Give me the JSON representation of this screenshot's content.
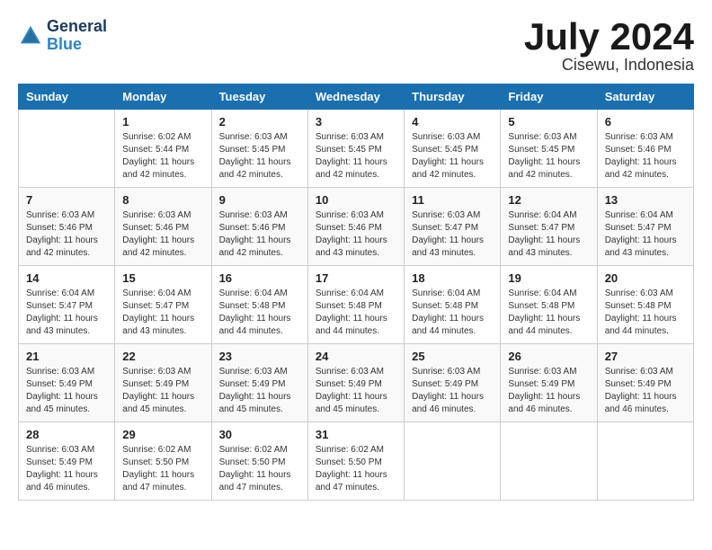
{
  "header": {
    "logo_line1": "General",
    "logo_line2": "Blue",
    "title": "July 2024",
    "subtitle": "Cisewu, Indonesia"
  },
  "days_of_week": [
    "Sunday",
    "Monday",
    "Tuesday",
    "Wednesday",
    "Thursday",
    "Friday",
    "Saturday"
  ],
  "weeks": [
    [
      {
        "day": "",
        "info": ""
      },
      {
        "day": "1",
        "info": "Sunrise: 6:02 AM\nSunset: 5:44 PM\nDaylight: 11 hours\nand 42 minutes."
      },
      {
        "day": "2",
        "info": "Sunrise: 6:03 AM\nSunset: 5:45 PM\nDaylight: 11 hours\nand 42 minutes."
      },
      {
        "day": "3",
        "info": "Sunrise: 6:03 AM\nSunset: 5:45 PM\nDaylight: 11 hours\nand 42 minutes."
      },
      {
        "day": "4",
        "info": "Sunrise: 6:03 AM\nSunset: 5:45 PM\nDaylight: 11 hours\nand 42 minutes."
      },
      {
        "day": "5",
        "info": "Sunrise: 6:03 AM\nSunset: 5:45 PM\nDaylight: 11 hours\nand 42 minutes."
      },
      {
        "day": "6",
        "info": "Sunrise: 6:03 AM\nSunset: 5:46 PM\nDaylight: 11 hours\nand 42 minutes."
      }
    ],
    [
      {
        "day": "7",
        "info": "Sunrise: 6:03 AM\nSunset: 5:46 PM\nDaylight: 11 hours\nand 42 minutes."
      },
      {
        "day": "8",
        "info": "Sunrise: 6:03 AM\nSunset: 5:46 PM\nDaylight: 11 hours\nand 42 minutes."
      },
      {
        "day": "9",
        "info": "Sunrise: 6:03 AM\nSunset: 5:46 PM\nDaylight: 11 hours\nand 42 minutes."
      },
      {
        "day": "10",
        "info": "Sunrise: 6:03 AM\nSunset: 5:46 PM\nDaylight: 11 hours\nand 43 minutes."
      },
      {
        "day": "11",
        "info": "Sunrise: 6:03 AM\nSunset: 5:47 PM\nDaylight: 11 hours\nand 43 minutes."
      },
      {
        "day": "12",
        "info": "Sunrise: 6:04 AM\nSunset: 5:47 PM\nDaylight: 11 hours\nand 43 minutes."
      },
      {
        "day": "13",
        "info": "Sunrise: 6:04 AM\nSunset: 5:47 PM\nDaylight: 11 hours\nand 43 minutes."
      }
    ],
    [
      {
        "day": "14",
        "info": "Sunrise: 6:04 AM\nSunset: 5:47 PM\nDaylight: 11 hours\nand 43 minutes."
      },
      {
        "day": "15",
        "info": "Sunrise: 6:04 AM\nSunset: 5:47 PM\nDaylight: 11 hours\nand 43 minutes."
      },
      {
        "day": "16",
        "info": "Sunrise: 6:04 AM\nSunset: 5:48 PM\nDaylight: 11 hours\nand 44 minutes."
      },
      {
        "day": "17",
        "info": "Sunrise: 6:04 AM\nSunset: 5:48 PM\nDaylight: 11 hours\nand 44 minutes."
      },
      {
        "day": "18",
        "info": "Sunrise: 6:04 AM\nSunset: 5:48 PM\nDaylight: 11 hours\nand 44 minutes."
      },
      {
        "day": "19",
        "info": "Sunrise: 6:04 AM\nSunset: 5:48 PM\nDaylight: 11 hours\nand 44 minutes."
      },
      {
        "day": "20",
        "info": "Sunrise: 6:03 AM\nSunset: 5:48 PM\nDaylight: 11 hours\nand 44 minutes."
      }
    ],
    [
      {
        "day": "21",
        "info": "Sunrise: 6:03 AM\nSunset: 5:49 PM\nDaylight: 11 hours\nand 45 minutes."
      },
      {
        "day": "22",
        "info": "Sunrise: 6:03 AM\nSunset: 5:49 PM\nDaylight: 11 hours\nand 45 minutes."
      },
      {
        "day": "23",
        "info": "Sunrise: 6:03 AM\nSunset: 5:49 PM\nDaylight: 11 hours\nand 45 minutes."
      },
      {
        "day": "24",
        "info": "Sunrise: 6:03 AM\nSunset: 5:49 PM\nDaylight: 11 hours\nand 45 minutes."
      },
      {
        "day": "25",
        "info": "Sunrise: 6:03 AM\nSunset: 5:49 PM\nDaylight: 11 hours\nand 46 minutes."
      },
      {
        "day": "26",
        "info": "Sunrise: 6:03 AM\nSunset: 5:49 PM\nDaylight: 11 hours\nand 46 minutes."
      },
      {
        "day": "27",
        "info": "Sunrise: 6:03 AM\nSunset: 5:49 PM\nDaylight: 11 hours\nand 46 minutes."
      }
    ],
    [
      {
        "day": "28",
        "info": "Sunrise: 6:03 AM\nSunset: 5:49 PM\nDaylight: 11 hours\nand 46 minutes."
      },
      {
        "day": "29",
        "info": "Sunrise: 6:02 AM\nSunset: 5:50 PM\nDaylight: 11 hours\nand 47 minutes."
      },
      {
        "day": "30",
        "info": "Sunrise: 6:02 AM\nSunset: 5:50 PM\nDaylight: 11 hours\nand 47 minutes."
      },
      {
        "day": "31",
        "info": "Sunrise: 6:02 AM\nSunset: 5:50 PM\nDaylight: 11 hours\nand 47 minutes."
      },
      {
        "day": "",
        "info": ""
      },
      {
        "day": "",
        "info": ""
      },
      {
        "day": "",
        "info": ""
      }
    ]
  ]
}
